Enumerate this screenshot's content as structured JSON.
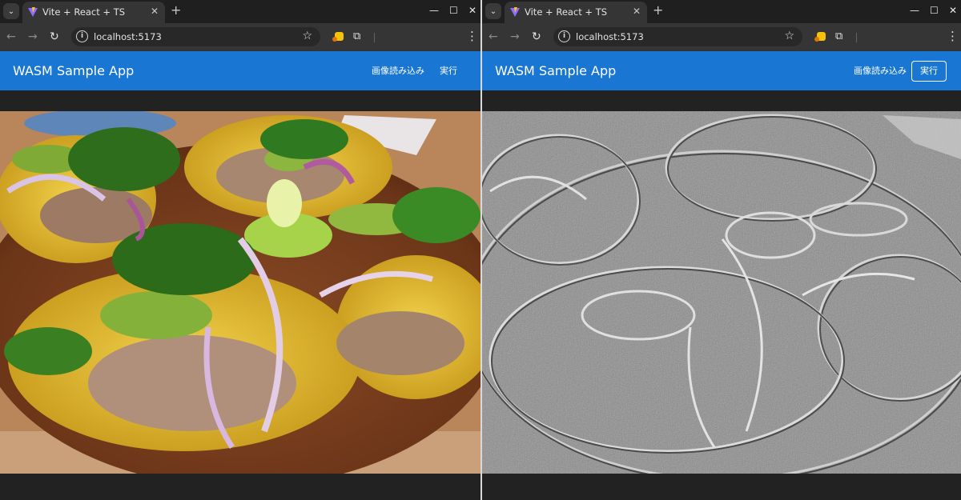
{
  "windows": [
    {
      "tab": {
        "title": "Vite + React + TS"
      },
      "address": {
        "url": "localhost:5173"
      },
      "app": {
        "title": "WASM Sample App",
        "load_button": "画像読み込み",
        "run_button": "実行"
      },
      "image": {
        "kind": "original-photo"
      }
    },
    {
      "tab": {
        "title": "Vite + React + TS"
      },
      "address": {
        "url": "localhost:5173"
      },
      "app": {
        "title": "WASM Sample App",
        "load_button": "画像読み込み",
        "run_button": "実行"
      },
      "image": {
        "kind": "processed-emboss-grayscale"
      }
    }
  ],
  "icons": {
    "tab_search": "chevron-down-icon",
    "favicon": "vite-logo-icon",
    "tab_close": "close-icon",
    "new_tab": "plus-icon",
    "back": "arrow-left-icon",
    "forward": "arrow-right-icon",
    "reload": "reload-icon",
    "site_info": "info-icon",
    "bookmark": "star-icon",
    "extension": "extension-icon",
    "extensions_menu": "puzzle-icon",
    "menu": "kebab-menu-icon",
    "minimize": "minimize-icon",
    "maximize": "maximize-icon",
    "close_window": "close-icon"
  },
  "colors": {
    "app_bar": "#1976d2",
    "browser_frame": "#1f1f1f",
    "toolbar": "#353535",
    "content_bg": "#222222"
  }
}
